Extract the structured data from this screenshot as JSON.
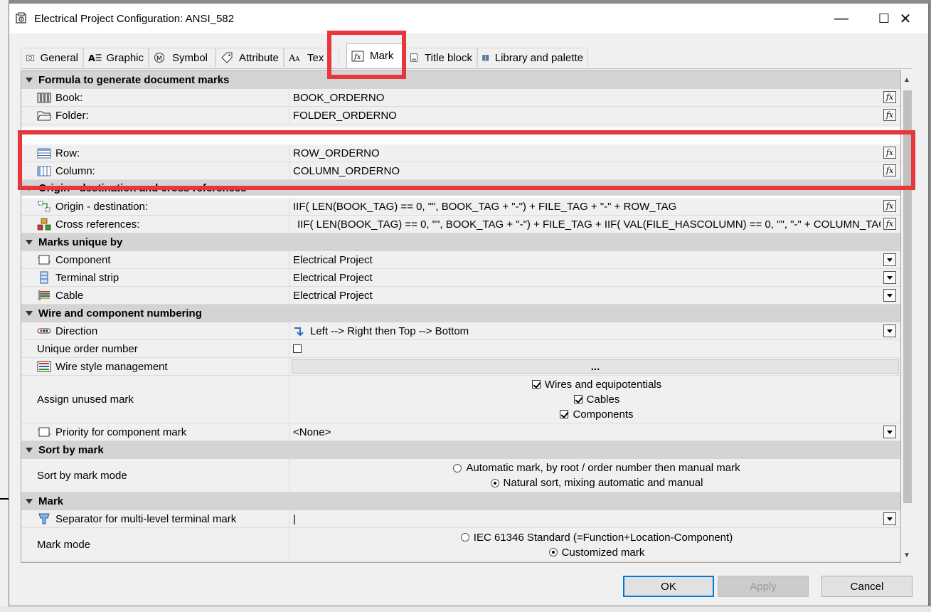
{
  "window": {
    "title": "Electrical Project Configuration: ANSI_582",
    "controls": {
      "minimize": "—",
      "maximize": "☐",
      "close": "✕"
    }
  },
  "tabs": [
    {
      "label": "General",
      "icon": "general-icon"
    },
    {
      "label": "Graphic",
      "icon": "graphic-icon"
    },
    {
      "label": "Symbol",
      "icon": "symbol-icon"
    },
    {
      "label": "Attribute",
      "icon": "attribute-icon"
    },
    {
      "label": "Tex",
      "icon": "text-icon"
    },
    {
      "label": "Mark",
      "icon": "formula-icon",
      "active": true
    },
    {
      "label": "Title block",
      "icon": "title-block-icon"
    },
    {
      "label": "Library and palette",
      "icon": "library-icon"
    }
  ],
  "grid": {
    "sections": {
      "formula": "Formula to generate document marks",
      "origin": "Origin - destination and cross references",
      "marks_unique": "Marks unique by",
      "wire_numbering": "Wire and component numbering",
      "sort_by_mark": "Sort by mark",
      "mark": "Mark"
    },
    "formula_rows": {
      "book": {
        "label": "Book:",
        "value": "BOOK_ORDERNO"
      },
      "folder": {
        "label": "Folder:",
        "value": "FOLDER_ORDERNO"
      },
      "row": {
        "label": "Row:",
        "value": "ROW_ORDERNO"
      },
      "column": {
        "label": "Column:",
        "value": "COLUMN_ORDERNO"
      }
    },
    "origin_rows": {
      "origin_destination": {
        "label": "Origin - destination:",
        "value": "IIF( LEN(BOOK_TAG) == 0, \"\", BOOK_TAG + \"-\") + FILE_TAG + \"-\" + ROW_TAG"
      },
      "cross_references": {
        "label": "Cross references:",
        "value": "IIF( LEN(BOOK_TAG) == 0, \"\", BOOK_TAG + \"-\") + FILE_TAG + IIF( VAL(FILE_HASCOLUMN) == 0, \"\", \"-\" + COLUMN_TAG"
      }
    },
    "unique_rows": {
      "component": {
        "label": "Component",
        "value": "Electrical Project"
      },
      "terminal_strip": {
        "label": "Terminal strip",
        "value": "Electrical Project"
      },
      "cable": {
        "label": "Cable",
        "value": "Electrical Project"
      }
    },
    "numbering_rows": {
      "direction": {
        "label": "Direction",
        "value": "Left --> Right then Top --> Bottom"
      },
      "unique_order": {
        "label": "Unique order number",
        "checked": false
      },
      "wire_style": {
        "label": "Wire style management",
        "button": "..."
      },
      "assign_unused": {
        "label": "Assign unused mark",
        "options": [
          {
            "label": "Wires and equipotentials",
            "checked": true
          },
          {
            "label": "Cables",
            "checked": true
          },
          {
            "label": "Components",
            "checked": true
          }
        ]
      },
      "priority": {
        "label": "Priority for component mark",
        "value": "<None>"
      }
    },
    "sort_rows": {
      "mode": {
        "label": "Sort by mark mode",
        "options": [
          {
            "label": "Automatic mark, by root / order number then manual mark",
            "selected": false
          },
          {
            "label": "Natural sort, mixing automatic and manual",
            "selected": true
          }
        ]
      }
    },
    "mark_rows": {
      "separator": {
        "label": "Separator for multi-level terminal mark",
        "value": "|"
      },
      "mark_mode": {
        "label": "Mark mode",
        "options": [
          {
            "label": "IEC 61346 Standard (=Function+Location-Component)",
            "selected": false
          },
          {
            "label": "Customized mark",
            "selected": true
          }
        ]
      }
    }
  },
  "buttons": {
    "ok": "OK",
    "apply": "Apply",
    "cancel": "Cancel"
  },
  "colors": {
    "highlight": "#e8363d",
    "category_bg": "#d4d4d4",
    "accent": "#0078d7"
  }
}
